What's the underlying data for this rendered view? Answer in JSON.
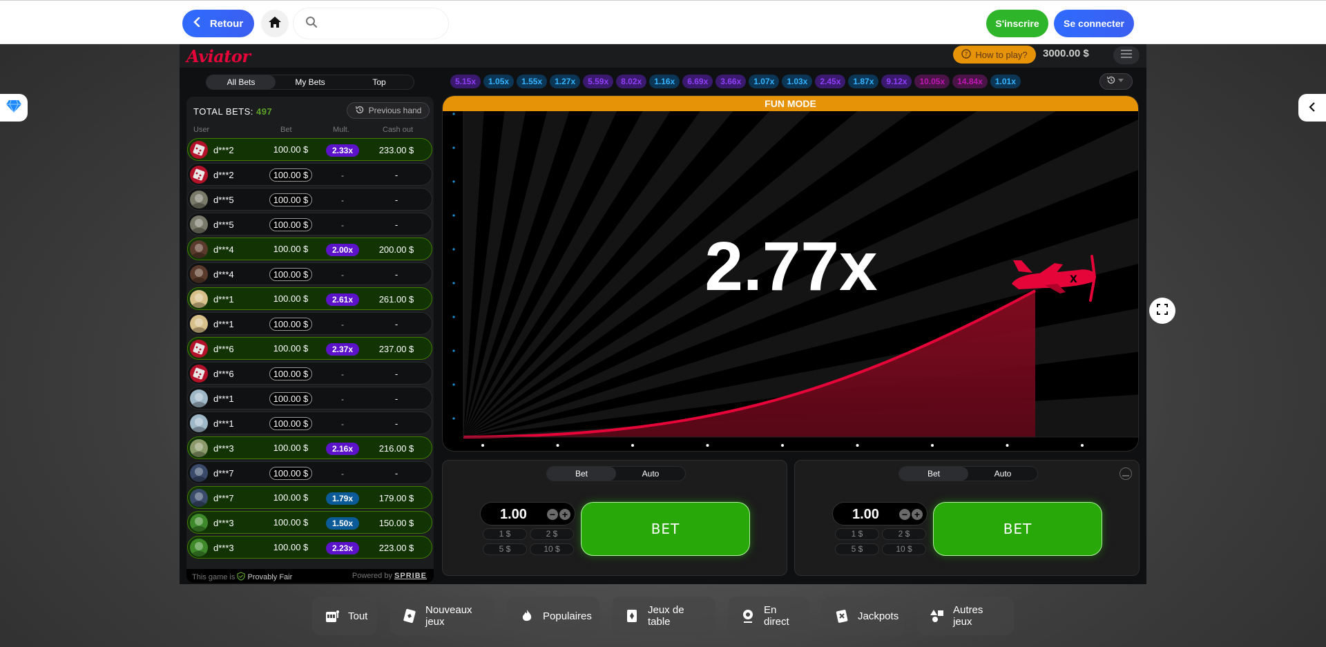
{
  "topbar": {
    "back_label": "Retour",
    "search_placeholder": "",
    "signup_label": "S'inscrire",
    "login_label": "Se connecter"
  },
  "game": {
    "logo": "Aviator",
    "how_to_play": "How to play?",
    "balance": "3000.00 $",
    "bets_tabs": [
      "All Bets",
      "My Bets",
      "Top"
    ],
    "total_bets_label": "TOTAL BETS:",
    "total_bets_count": "497",
    "previous_hand": "Previous hand",
    "columns": {
      "user": "User",
      "bet": "Bet",
      "mult": "Mult.",
      "cashout": "Cash out"
    },
    "bets": [
      {
        "user": "d***2",
        "bet": "100.00 $",
        "mult": "2.33x",
        "cash": "233.00 $",
        "win": true,
        "mcolor": "#5b12c8",
        "avatar": "dice"
      },
      {
        "user": "d***2",
        "bet": "100.00 $",
        "mult": "-",
        "cash": "-",
        "win": false,
        "avatar": "dice"
      },
      {
        "user": "d***5",
        "bet": "100.00 $",
        "mult": "-",
        "cash": "-",
        "win": false,
        "avatar": "raccoon"
      },
      {
        "user": "d***5",
        "bet": "100.00 $",
        "mult": "-",
        "cash": "-",
        "win": false,
        "avatar": "raccoon"
      },
      {
        "user": "d***4",
        "bet": "100.00 $",
        "mult": "2.00x",
        "cash": "200.00 $",
        "win": true,
        "mcolor": "#5b12c8",
        "avatar": "pirate"
      },
      {
        "user": "d***4",
        "bet": "100.00 $",
        "mult": "-",
        "cash": "-",
        "win": false,
        "avatar": "pirate"
      },
      {
        "user": "d***1",
        "bet": "100.00 $",
        "mult": "2.61x",
        "cash": "261.00 $",
        "win": true,
        "mcolor": "#5b12c8",
        "avatar": "cat"
      },
      {
        "user": "d***1",
        "bet": "100.00 $",
        "mult": "-",
        "cash": "-",
        "win": false,
        "avatar": "cat"
      },
      {
        "user": "d***6",
        "bet": "100.00 $",
        "mult": "2.37x",
        "cash": "237.00 $",
        "win": true,
        "mcolor": "#5b12c8",
        "avatar": "dice"
      },
      {
        "user": "d***6",
        "bet": "100.00 $",
        "mult": "-",
        "cash": "-",
        "win": false,
        "avatar": "dice"
      },
      {
        "user": "d***1",
        "bet": "100.00 $",
        "mult": "-",
        "cash": "-",
        "win": false,
        "avatar": "snow"
      },
      {
        "user": "d***1",
        "bet": "100.00 $",
        "mult": "-",
        "cash": "-",
        "win": false,
        "avatar": "snow"
      },
      {
        "user": "d***3",
        "bet": "100.00 $",
        "mult": "2.16x",
        "cash": "216.00 $",
        "win": true,
        "mcolor": "#5b12c8",
        "avatar": "land"
      },
      {
        "user": "d***7",
        "bet": "100.00 $",
        "mult": "-",
        "cash": "-",
        "win": false,
        "avatar": "astro"
      },
      {
        "user": "d***7",
        "bet": "100.00 $",
        "mult": "1.79x",
        "cash": "179.00 $",
        "win": true,
        "mcolor": "#0b5b98",
        "avatar": "astro"
      },
      {
        "user": "d***3",
        "bet": "100.00 $",
        "mult": "1.50x",
        "cash": "150.00 $",
        "win": true,
        "mcolor": "#0b5b98",
        "avatar": "leaf"
      },
      {
        "user": "d***3",
        "bet": "100.00 $",
        "mult": "2.23x",
        "cash": "223.00 $",
        "win": true,
        "mcolor": "#5b12c8",
        "avatar": "leaf"
      }
    ],
    "footer_prefix": "This game is",
    "provably_fair": "Provably Fair",
    "powered_by": "Powered by",
    "spribe": "SPRIBE",
    "history": [
      {
        "v": "5.15x",
        "c": "#913ef8",
        "bg": "#3a1a6e"
      },
      {
        "v": "1.05x",
        "c": "#34b4ff",
        "bg": "#0c3656"
      },
      {
        "v": "1.55x",
        "c": "#34b4ff",
        "bg": "#0c3656"
      },
      {
        "v": "1.27x",
        "c": "#34b4ff",
        "bg": "#0c3656"
      },
      {
        "v": "5.59x",
        "c": "#913ef8",
        "bg": "#3a1a6e"
      },
      {
        "v": "8.02x",
        "c": "#913ef8",
        "bg": "#3a1a6e"
      },
      {
        "v": "1.16x",
        "c": "#34b4ff",
        "bg": "#0c3656"
      },
      {
        "v": "6.69x",
        "c": "#913ef8",
        "bg": "#3a1a6e"
      },
      {
        "v": "3.66x",
        "c": "#913ef8",
        "bg": "#3a1a6e"
      },
      {
        "v": "1.07x",
        "c": "#34b4ff",
        "bg": "#0c3656"
      },
      {
        "v": "1.03x",
        "c": "#34b4ff",
        "bg": "#0c3656"
      },
      {
        "v": "2.45x",
        "c": "#913ef8",
        "bg": "#3a1a6e"
      },
      {
        "v": "1.87x",
        "c": "#34b4ff",
        "bg": "#0c3656"
      },
      {
        "v": "9.12x",
        "c": "#913ef8",
        "bg": "#3a1a6e"
      },
      {
        "v": "10.05x",
        "c": "#c017b4",
        "bg": "#4a1446"
      },
      {
        "v": "14.84x",
        "c": "#c017b4",
        "bg": "#4a1446"
      },
      {
        "v": "1.01x",
        "c": "#34b4ff",
        "bg": "#0c3656"
      }
    ],
    "fun_mode": "FUN MODE",
    "multiplier": "2.77x",
    "panels": [
      {
        "tabs": [
          "Bet",
          "Auto"
        ],
        "amount": "1.00",
        "quick": [
          "1 $",
          "2 $",
          "5 $",
          "10 $"
        ],
        "bet_label": "BET"
      },
      {
        "tabs": [
          "Bet",
          "Auto"
        ],
        "amount": "1.00",
        "quick": [
          "1 $",
          "2 $",
          "5 $",
          "10 $"
        ],
        "bet_label": "BET"
      }
    ]
  },
  "categories": [
    "Tout",
    "Nouveaux jeux",
    "Populaires",
    "Jeux de table",
    "En direct",
    "Jackpots",
    "Autres jeux"
  ],
  "colors": {
    "accent_green": "#28a909",
    "accent_red": "#e50539",
    "accent_orange": "#e69308",
    "blue": "#2f6bff"
  }
}
